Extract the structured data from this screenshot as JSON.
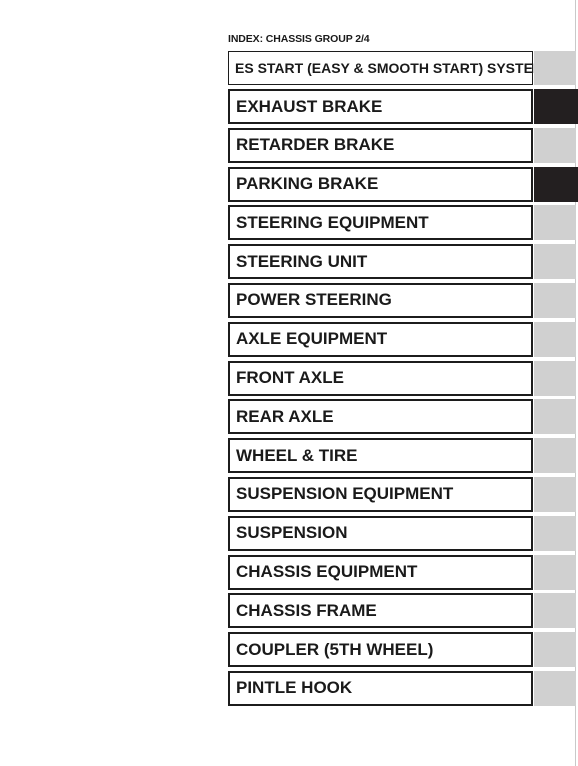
{
  "page": {
    "header": "INDEX: CHASSIS GROUP 2/4",
    "background_color": "#ffffff"
  },
  "colors": {
    "text": "#1a1a1a",
    "border": "#1c1c1c",
    "status_gray": "#d0d0d0",
    "status_black": "#231f20",
    "page_edge": "#c9c9c9"
  },
  "index_table": {
    "rows": [
      {
        "label": "ES START (EASY & SMOOTH START) SYSTEM",
        "status": "gray",
        "compact": true
      },
      {
        "label": "EXHAUST BRAKE",
        "status": "black",
        "compact": false
      },
      {
        "label": "RETARDER BRAKE",
        "status": "gray",
        "compact": false
      },
      {
        "label": "PARKING BRAKE",
        "status": "black",
        "compact": false
      },
      {
        "label": "STEERING EQUIPMENT",
        "status": "gray",
        "compact": false
      },
      {
        "label": "STEERING UNIT",
        "status": "gray",
        "compact": false
      },
      {
        "label": "POWER STEERING",
        "status": "gray",
        "compact": false
      },
      {
        "label": "AXLE EQUIPMENT",
        "status": "gray",
        "compact": false
      },
      {
        "label": "FRONT AXLE",
        "status": "gray",
        "compact": false
      },
      {
        "label": "REAR AXLE",
        "status": "gray",
        "compact": false
      },
      {
        "label": "WHEEL & TIRE",
        "status": "gray",
        "compact": false
      },
      {
        "label": "SUSPENSION EQUIPMENT",
        "status": "gray",
        "compact": false
      },
      {
        "label": "SUSPENSION",
        "status": "gray",
        "compact": false
      },
      {
        "label": "CHASSIS EQUIPMENT",
        "status": "gray",
        "compact": false
      },
      {
        "label": "CHASSIS FRAME",
        "status": "gray",
        "compact": false
      },
      {
        "label": "COUPLER (5TH WHEEL)",
        "status": "gray",
        "compact": false
      },
      {
        "label": "PINTLE HOOK",
        "status": "gray",
        "compact": false
      }
    ]
  }
}
